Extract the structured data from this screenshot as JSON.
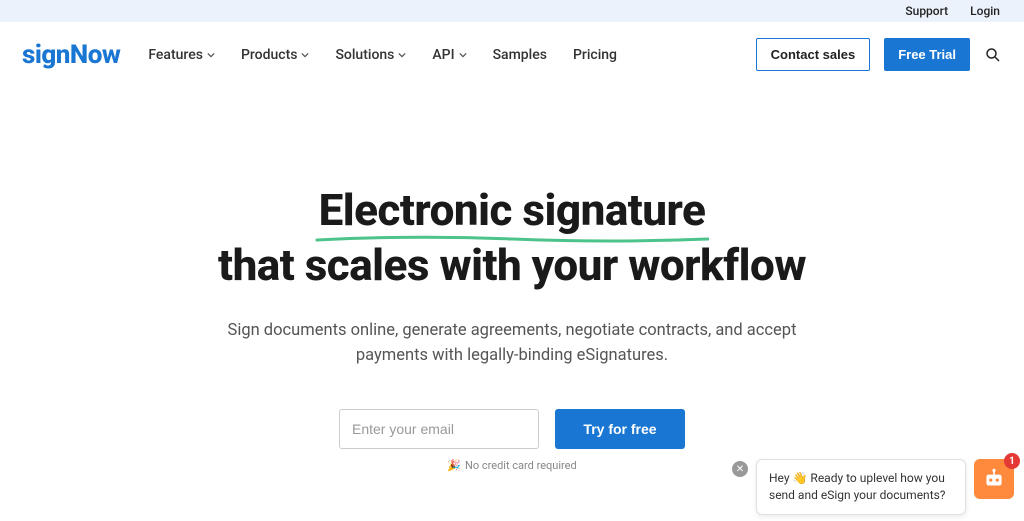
{
  "topbar": {
    "support": "Support",
    "login": "Login"
  },
  "logo": {
    "text": "signNow"
  },
  "nav": {
    "features": "Features",
    "products": "Products",
    "solutions": "Solutions",
    "api": "API",
    "samples": "Samples",
    "pricing": "Pricing"
  },
  "actions": {
    "contact": "Contact sales",
    "trial": "Free Trial"
  },
  "hero": {
    "line1": "Electronic signature",
    "line2": "that scales with your workflow",
    "sub": "Sign documents online, generate agreements, negotiate contracts, and accept payments with legally-binding eSignatures."
  },
  "cta": {
    "placeholder": "Enter your email",
    "button": "Try for free",
    "note_emoji": "🎉",
    "note": "No credit card required"
  },
  "chat": {
    "message": "Hey 👋 Ready to uplevel how you send and eSign your documents?",
    "badge": "1"
  }
}
